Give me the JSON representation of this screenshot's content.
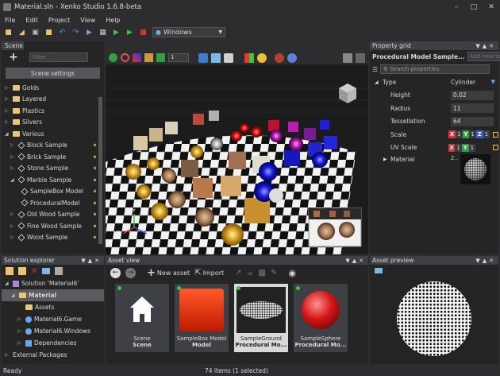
{
  "window": {
    "title": "Material.sln - Xenko Studio 1.6.8-beta"
  },
  "menu": [
    "File",
    "Edit",
    "Project",
    "View",
    "Help"
  ],
  "toolbar": {
    "platform": "Windows"
  },
  "scene_panel": {
    "tab": "Scene",
    "filter_placeholder": "Filter",
    "settings_button": "Scene settings",
    "zoom_value": "1",
    "tree": [
      {
        "label": "Golds",
        "kind": "folder"
      },
      {
        "label": "Layered",
        "kind": "folder"
      },
      {
        "label": "Plastics",
        "kind": "folder"
      },
      {
        "label": "Silvers",
        "kind": "folder"
      },
      {
        "label": "Various",
        "kind": "folder-open"
      },
      {
        "label": "Block Sample",
        "kind": "entity"
      },
      {
        "label": "Brick Sample",
        "kind": "entity"
      },
      {
        "label": "Stone Sample",
        "kind": "entity"
      },
      {
        "label": "Marble Sample",
        "kind": "entity-open"
      },
      {
        "label": "SampleBox Model",
        "kind": "child"
      },
      {
        "label": "ProceduralModel",
        "kind": "child"
      },
      {
        "label": "Old Wood Sample",
        "kind": "entity"
      },
      {
        "label": "Fine Wood Sample",
        "kind": "entity"
      },
      {
        "label": "Wood Sample",
        "kind": "entity"
      }
    ]
  },
  "property_grid": {
    "tab": "Property grid",
    "title": "Procedural Model Sample...",
    "tag_placeholder": "Add new tag",
    "search_placeholder": "Search properties",
    "type_label": "Type",
    "type_value": "Cylinder",
    "rows": [
      {
        "label": "Height",
        "value": "0.02"
      },
      {
        "label": "Radius",
        "value": "11"
      },
      {
        "label": "Tessellation",
        "value": "64"
      }
    ],
    "scale": {
      "label": "Scale",
      "x": "1",
      "y": "1",
      "z": "1"
    },
    "uv_scale": {
      "label": "UV Scale",
      "x": "1",
      "y": "1"
    },
    "material": {
      "label": "Material",
      "value": "Z..."
    }
  },
  "solution_explorer": {
    "tab": "Solution explorer",
    "tree": [
      {
        "label": "Solution 'Material6'",
        "level": 0
      },
      {
        "label": "Material",
        "level": 1,
        "selected": true
      },
      {
        "label": "Assets",
        "level": 2
      },
      {
        "label": "Material6.Game",
        "level": 2
      },
      {
        "label": "Material6.Windows",
        "level": 2
      },
      {
        "label": "Dependencies",
        "level": 2
      },
      {
        "label": "External Packages",
        "level": 0
      }
    ]
  },
  "asset_view": {
    "tab": "Asset view",
    "new_asset": "New asset",
    "import": "Import",
    "items": [
      {
        "name": "Scene",
        "type": "Scene",
        "thumb": "house"
      },
      {
        "name": "SampleBox Model",
        "type": "Model",
        "thumb": "red-cube"
      },
      {
        "name": "SampleGround",
        "type": "Procedural Mo...",
        "thumb": "disc",
        "selected": true
      },
      {
        "name": "SampleSphere",
        "type": "Procedural Mo...",
        "thumb": "red-sphere"
      }
    ]
  },
  "asset_preview": {
    "tab": "Asset preview"
  },
  "status": {
    "left": "Ready",
    "center": "74 items (1 selected)"
  }
}
